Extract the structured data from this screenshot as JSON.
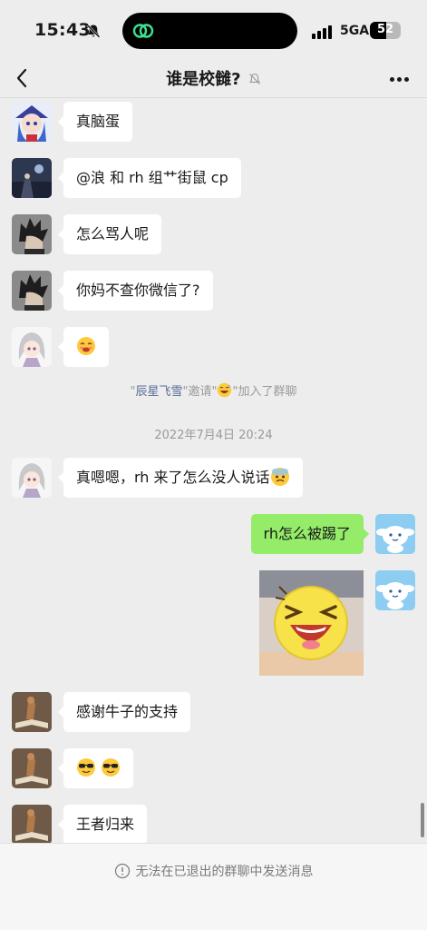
{
  "status_bar": {
    "time": "15:43",
    "network": "5GA",
    "battery": "52",
    "battery_level_percent": 52
  },
  "nav": {
    "title": "谁是校雠?"
  },
  "messages": [
    {
      "side": "left",
      "avatar": "anime-girl-blue-hat-avatar",
      "text": "真脑蛋"
    },
    {
      "side": "left",
      "avatar": "night-scene-avatar",
      "text": "@浪 和 rh 组艹街鼠 cp"
    },
    {
      "side": "left",
      "avatar": "dark-spiky-hair-avatar",
      "text": "怎么骂人呢"
    },
    {
      "side": "left",
      "avatar": "dark-spiky-hair-avatar",
      "text": "你妈不查你微信了?"
    },
    {
      "side": "left",
      "avatar": "silver-hair-girl-avatar",
      "emoji": "drooling-face-emoji"
    },
    {
      "side": "left",
      "avatar": "silver-hair-girl-avatar",
      "text": "真嗯嗯，rh 来了怎么没人说话",
      "emoji": "anxious-sweat-emoji"
    },
    {
      "side": "right",
      "avatar": "cinnamoroll-avatar",
      "text": "rh怎么被踢了"
    },
    {
      "side": "right",
      "avatar": "cinnamoroll-avatar",
      "sticker": "laughing-yellow-face-sticker"
    },
    {
      "side": "left",
      "avatar": "book-figure-avatar",
      "text": "感谢牛子的支持"
    },
    {
      "side": "left",
      "avatar": "book-figure-avatar",
      "emoji": "sunglasses-emoji"
    },
    {
      "side": "left",
      "avatar": "book-figure-avatar",
      "text": "王者归来"
    }
  ],
  "system": {
    "invite_quote_open": "\"",
    "invite_name": "辰星飞雪",
    "invite_mid": "\"邀请\"",
    "invite_end": "\"加入了群聊",
    "timestamp": "2022年7月4日 20:24"
  },
  "footer": {
    "notice": "无法在已退出的群聊中发送消息"
  },
  "colors": {
    "background": "#ededed",
    "my_bubble": "#95ec69",
    "other_bubble": "#ffffff",
    "link": "#576b95"
  }
}
